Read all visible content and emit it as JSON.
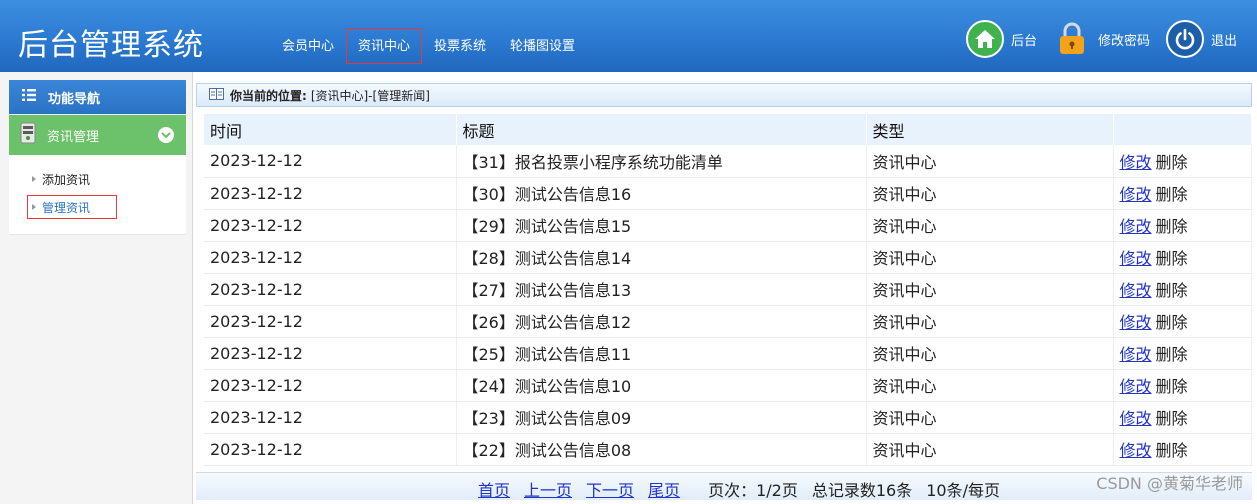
{
  "app": {
    "title": "后台管理系统"
  },
  "topnav": {
    "items": [
      {
        "label": "会员中心",
        "active": false
      },
      {
        "label": "资讯中心",
        "active": true
      },
      {
        "label": "投票系统",
        "active": false
      },
      {
        "label": "轮播图设置",
        "active": false
      }
    ]
  },
  "tools": {
    "home_label": "后台",
    "password_label": "修改密码",
    "logout_label": "退出"
  },
  "sidebar": {
    "header_label": "功能导航",
    "group_label": "资讯管理",
    "items": [
      {
        "label": "添加资讯",
        "active": false
      },
      {
        "label": "管理资讯",
        "active": true
      }
    ]
  },
  "breadcrumb": {
    "label": "你当前的位置:",
    "path": "[资讯中心]-[管理新闻]"
  },
  "table": {
    "headers": [
      "时间",
      "标题",
      "类型",
      ""
    ],
    "edit_label": "修改",
    "delete_label": "删除",
    "rows": [
      {
        "time": "2023-12-12",
        "title": "【31】报名投票小程序系统功能清单",
        "type": "资讯中心"
      },
      {
        "time": "2023-12-12",
        "title": "【30】测试公告信息16",
        "type": "资讯中心"
      },
      {
        "time": "2023-12-12",
        "title": "【29】测试公告信息15",
        "type": "资讯中心"
      },
      {
        "time": "2023-12-12",
        "title": "【28】测试公告信息14",
        "type": "资讯中心"
      },
      {
        "time": "2023-12-12",
        "title": "【27】测试公告信息13",
        "type": "资讯中心"
      },
      {
        "time": "2023-12-12",
        "title": "【26】测试公告信息12",
        "type": "资讯中心"
      },
      {
        "time": "2023-12-12",
        "title": "【25】测试公告信息11",
        "type": "资讯中心"
      },
      {
        "time": "2023-12-12",
        "title": "【24】测试公告信息10",
        "type": "资讯中心"
      },
      {
        "time": "2023-12-12",
        "title": "【23】测试公告信息09",
        "type": "资讯中心"
      },
      {
        "time": "2023-12-12",
        "title": "【22】测试公告信息08",
        "type": "资讯中心"
      }
    ]
  },
  "pagination": {
    "first": "首页",
    "prev": "上一页",
    "next": "下一页",
    "last": "尾页",
    "page_info": "页次：1/2页",
    "total_info": "总记录数16条",
    "per_page_info": "10条/每页"
  },
  "watermark": "CSDN @黄菊华老师",
  "colors": {
    "header_blue": "#2a78d0",
    "group_green": "#6bc26a",
    "link_blue": "#2233cc",
    "highlight_red": "#e23b3b"
  }
}
